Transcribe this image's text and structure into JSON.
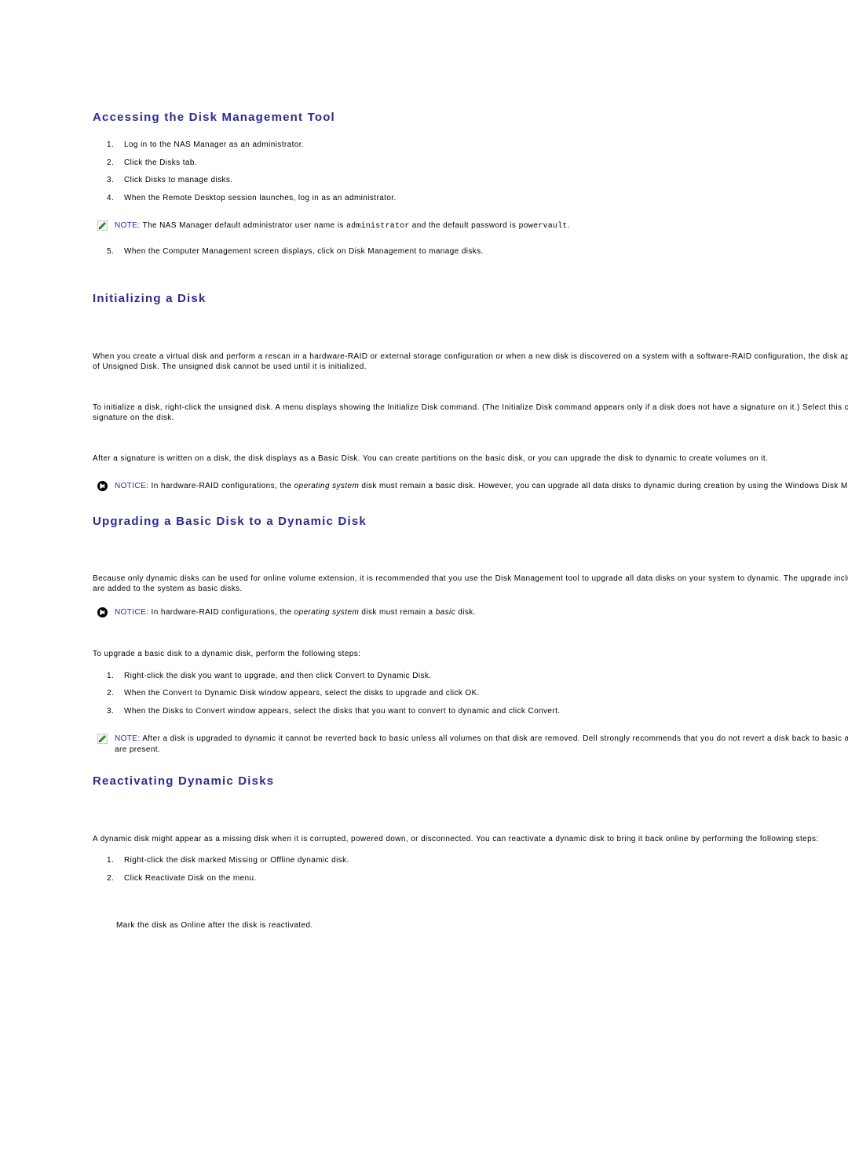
{
  "sections": {
    "accessing": {
      "heading": "Accessing the Disk Management Tool",
      "steps_a": [
        "Log in to the NAS Manager as an administrator.",
        "Click the Disks tab.",
        "Click Disks to manage disks.",
        "When the Remote Desktop session launches, log in as an administrator."
      ],
      "note": {
        "lead": "NOTE:",
        "pre": " The NAS Manager default administrator user name is ",
        "code1": "administrator",
        "mid": " and the default password is ",
        "code2": "powervault",
        "post": "."
      },
      "steps_b_start": 5,
      "steps_b": [
        "When the Computer Management screen displays, click on Disk Management to manage disks."
      ]
    },
    "initializing": {
      "heading": "Initializing a Disk",
      "p1": "When you create a virtual disk and perform a rescan in a hardware-RAID or external storage configuration or when a new disk is discovered on a system with a software-RAID configuration, the disk appears with a Disk Type of Unsigned Disk. The unsigned disk cannot be used until it is initialized.",
      "p2": "To initialize a disk, right-click the unsigned disk. A menu displays showing the Initialize Disk command. (The Initialize Disk command appears only if a disk does not have a signature on it.) Select this command to write a signature on the disk.",
      "p3": "After a signature is written on a disk, the disk displays as a Basic Disk. You can create partitions on the basic disk, or you can upgrade the disk to dynamic to create volumes on it.",
      "notice": {
        "lead": "NOTICE:",
        "pre": " In hardware-RAID configurations, the ",
        "em": "operating system",
        "post": " disk must remain a basic disk. However, you can upgrade all data disks to dynamic during creation by using the Windows Disk Management tool."
      }
    },
    "upgrading": {
      "heading": "Upgrading a Basic Disk to a Dynamic Disk",
      "p1": "Because only dynamic disks can be used for online volume extension, it is recommended that you use the Disk Management tool to upgrade all data disks on your system to dynamic. The upgrade includes new disks, which are added to the system as basic disks.",
      "notice": {
        "lead": "NOTICE:",
        "pre": " In hardware-RAID configurations, the ",
        "em1": "operating system",
        "mid": " disk must remain a ",
        "em2": "basic",
        "post": " disk."
      },
      "p2": "To upgrade a basic disk to a dynamic disk, perform the following steps:",
      "steps": [
        "Right-click the disk you want to upgrade, and then click Convert to Dynamic Disk.",
        "When the Convert to Dynamic Disk window appears, select the disks to upgrade and click OK.",
        "When the Disks to Convert window appears, select the disks that you want to convert to dynamic and click Convert."
      ],
      "note": {
        "lead": "NOTE:",
        "text": " After a disk is upgraded to dynamic it cannot be reverted back to basic unless all volumes on that disk are removed. Dell strongly recommends that you do not revert a disk back to basic after data volumes are present."
      }
    },
    "reactivating": {
      "heading": "Reactivating Dynamic Disks",
      "p1": "A dynamic disk might appear as a missing disk when it is corrupted, powered down, or disconnected. You can reactivate a dynamic disk to bring it back online by performing the following steps:",
      "steps": [
        "Right-click the disk marked Missing or Offline dynamic disk.",
        "Click Reactivate Disk on the menu."
      ],
      "p2": "Mark the disk as Online after the disk is reactivated."
    }
  }
}
